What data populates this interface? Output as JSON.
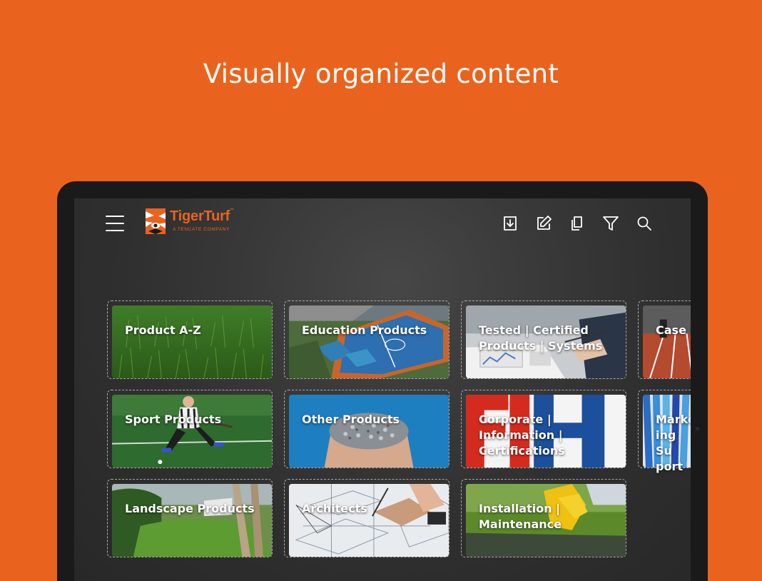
{
  "headline": "Visually organized content",
  "app": {
    "brand_name": "TigerTurf",
    "brand_tm": "™",
    "brand_tagline": "A TENCATE COMPANY",
    "colors": {
      "accent": "#ea631e",
      "background": "#2f2f2f",
      "text": "#ffffff"
    }
  },
  "toolbar": {
    "icons": [
      "download-icon",
      "edit-icon",
      "copy-icon",
      "filter-icon",
      "search-icon"
    ]
  },
  "tiles": [
    {
      "label": "Product A-Z",
      "image": "artificial-grass"
    },
    {
      "label": "Education Products",
      "image": "school-sports-court-aerial"
    },
    {
      "label": "Tested | Certified Products | Systems",
      "image": "business-meeting-documents"
    },
    {
      "label": "Case Studie",
      "image": "running-track"
    },
    {
      "label": "Sport Products",
      "image": "field-hockey-player"
    },
    {
      "label": "Other Products",
      "image": "hands-holding-gravel"
    },
    {
      "label": "Corporate | Information | Certifications",
      "image": "fih-logo"
    },
    {
      "label": "Marke ing Su port",
      "image": "colored-pencils"
    },
    {
      "label": "Landscape Products",
      "image": "garden-lawn"
    },
    {
      "label": "Architects",
      "image": "architect-drawings"
    },
    {
      "label": "Installation | Maintenance",
      "image": "gloved-hand-on-turf"
    }
  ]
}
